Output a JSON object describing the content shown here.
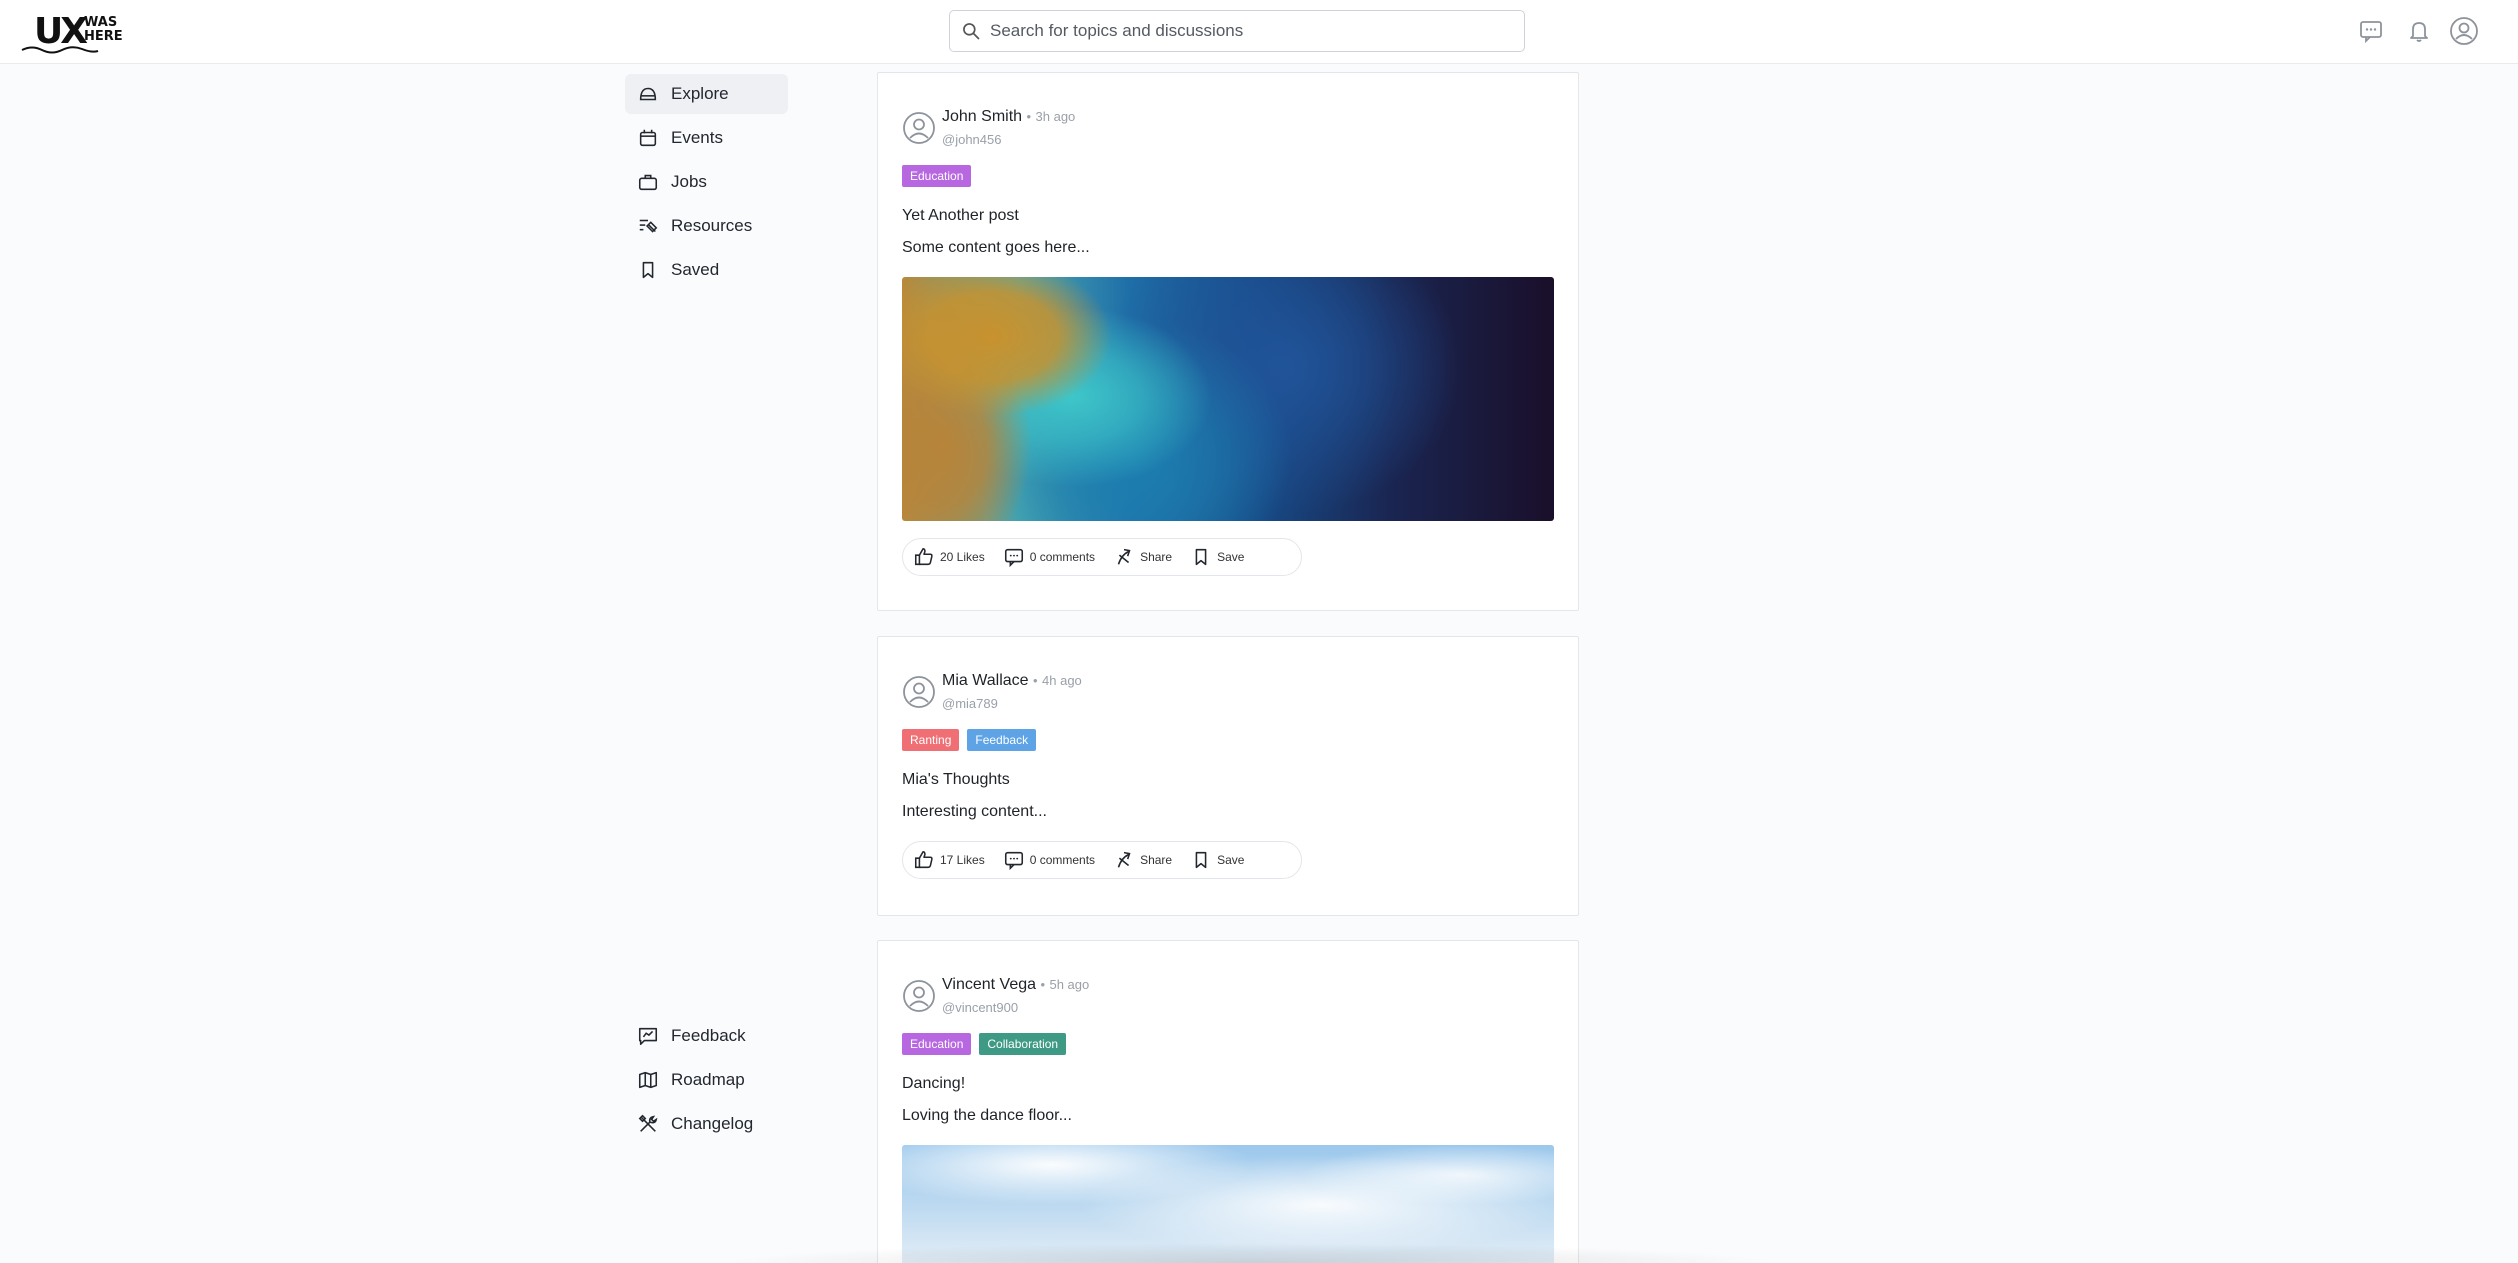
{
  "header": {
    "logo_text_main": "UX",
    "logo_text_sub_1": "WAS",
    "logo_text_sub_2": "HERE",
    "search_placeholder": "Search for topics and discussions",
    "icons": [
      "message-icon",
      "bell-icon",
      "user-icon"
    ]
  },
  "sidebar": {
    "primary": [
      {
        "label": "Explore",
        "icon": "home-icon",
        "active": true
      },
      {
        "label": "Events",
        "icon": "calendar-icon"
      },
      {
        "label": "Jobs",
        "icon": "briefcase-icon"
      },
      {
        "label": "Resources",
        "icon": "resources-icon"
      },
      {
        "label": "Saved",
        "icon": "bookmark-icon"
      }
    ],
    "secondary": [
      {
        "label": "Feedback",
        "icon": "feedback-icon"
      },
      {
        "label": "Roadmap",
        "icon": "map-icon"
      },
      {
        "label": "Changelog",
        "icon": "tools-icon"
      }
    ]
  },
  "posts": [
    {
      "author": "John Smith",
      "time": "3h ago",
      "handle": "@john456",
      "tags": [
        {
          "label": "Education",
          "color": "#b768e0"
        }
      ],
      "title": "Yet Another post",
      "excerpt": "Some content goes here...",
      "likes": "20 Likes",
      "comments": "0 comments",
      "share": "Share",
      "save": "Save"
    },
    {
      "author": "Mia Wallace",
      "time": "4h ago",
      "handle": "@mia789",
      "tags": [
        {
          "label": "Ranting",
          "color": "#ef6f74"
        },
        {
          "label": "Feedback",
          "color": "#5ea3e6"
        }
      ],
      "title": "Mia's Thoughts",
      "excerpt": "Interesting content...",
      "likes": "17 Likes",
      "comments": "0 comments",
      "share": "Share",
      "save": "Save"
    },
    {
      "author": "Vincent Vega",
      "time": "5h ago",
      "handle": "@vincent900",
      "tags": [
        {
          "label": "Education",
          "color": "#b768e0"
        },
        {
          "label": "Collaboration",
          "color": "#3e9a85"
        }
      ],
      "title": "Dancing!",
      "excerpt": "Loving the dance floor..."
    }
  ]
}
